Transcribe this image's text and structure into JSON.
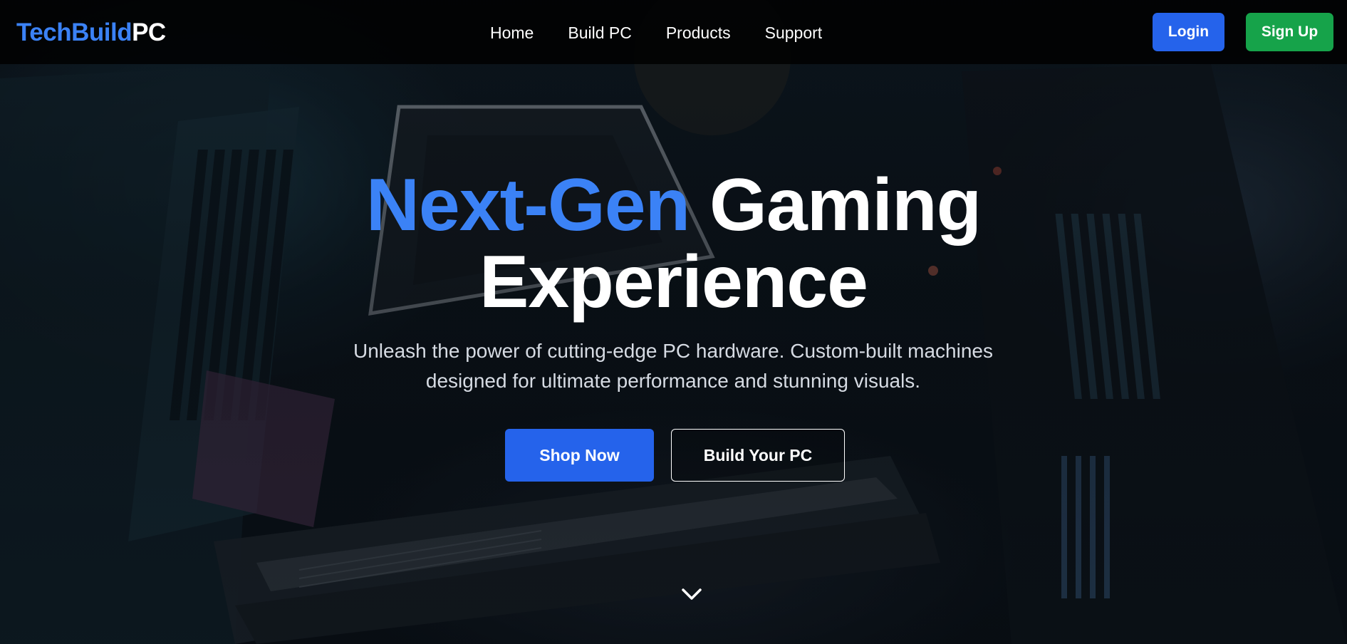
{
  "brand": {
    "logo_part1": "TechBuild",
    "logo_part2": "PC",
    "accent_color": "#3b82f6"
  },
  "nav": {
    "items": [
      {
        "label": "Home"
      },
      {
        "label": "Build PC"
      },
      {
        "label": "Products"
      },
      {
        "label": "Support"
      }
    ],
    "login_label": "Login",
    "signup_label": "Sign Up",
    "login_color": "#2563eb",
    "signup_color": "#16a34a"
  },
  "hero": {
    "title_accent": "Next-Gen",
    "title_rest_line1": "Gaming",
    "title_line2": "Experience",
    "subtitle_line1": "Unleash the power of cutting-edge PC hardware. Custom-built machines",
    "subtitle_line2": "designed for ultimate performance and stunning visuals.",
    "primary_cta": "Shop Now",
    "secondary_cta": "Build Your PC",
    "scroll_icon": "chevron-down-icon"
  }
}
